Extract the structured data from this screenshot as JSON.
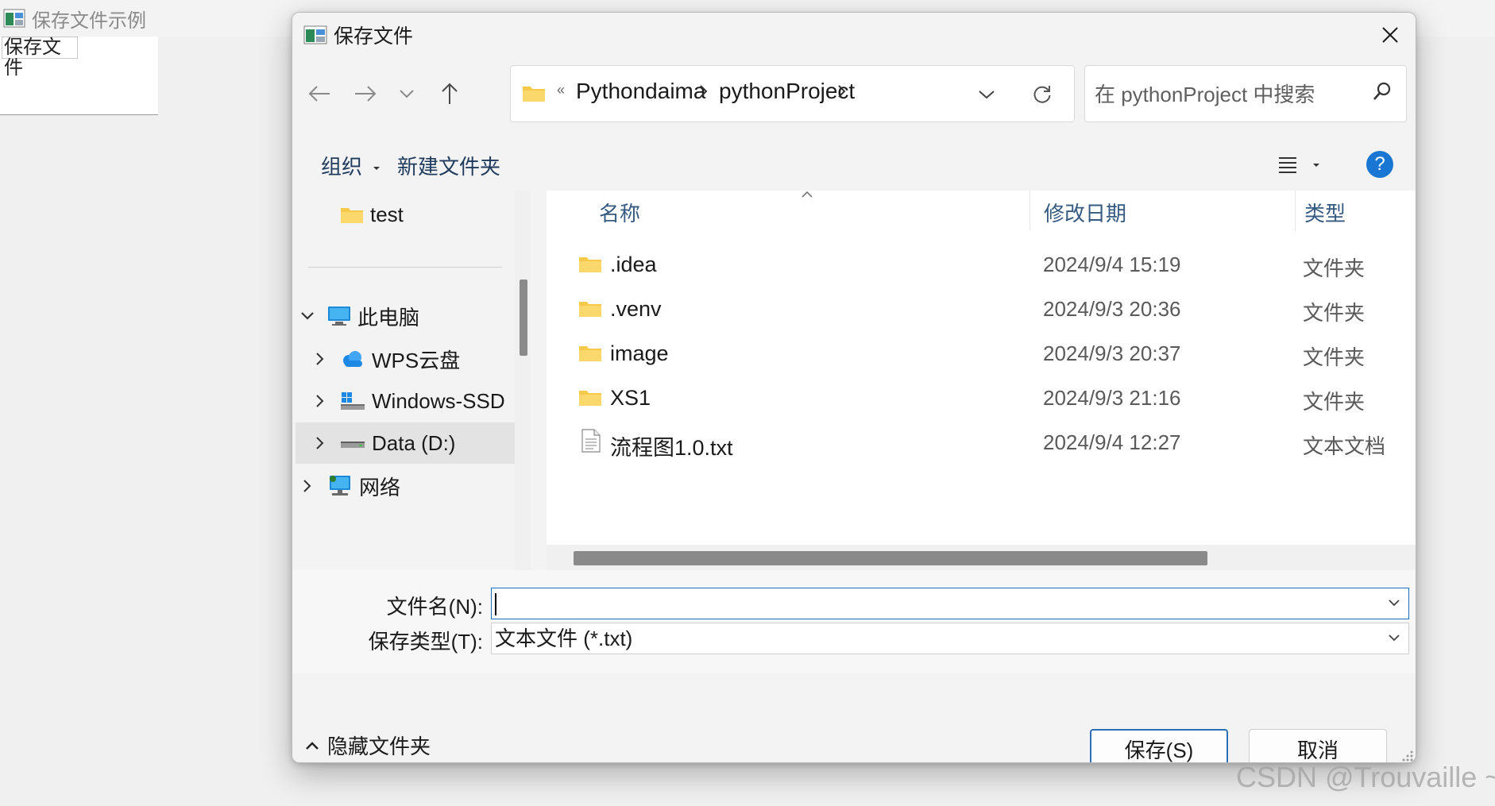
{
  "background_app": {
    "title": "保存文件示例",
    "button_label": "保存文件"
  },
  "dialog": {
    "title": "保存文件",
    "address": {
      "overflow_glyph": "«",
      "crumbs": [
        "Pythondaima",
        "pythonProject"
      ]
    },
    "search": {
      "placeholder": "在 pythonProject 中搜索"
    },
    "toolbar": {
      "organize_label": "组织",
      "new_folder_label": "新建文件夹",
      "help_label": "?"
    },
    "nav_pane": {
      "items": [
        {
          "label": "test",
          "icon": "folder-icon"
        },
        {
          "label": "此电脑",
          "icon": "computer-icon",
          "expanded": true
        },
        {
          "label": "WPS云盘",
          "icon": "cloud-icon"
        },
        {
          "label": "Windows-SSD",
          "icon": "drive-icon"
        },
        {
          "label": "Data (D:)",
          "icon": "drive-icon",
          "selected": true
        },
        {
          "label": "网络",
          "icon": "network-icon"
        }
      ]
    },
    "columns": {
      "name": "名称",
      "date": "修改日期",
      "type": "类型"
    },
    "files": [
      {
        "name": ".idea",
        "date": "2024/9/4 15:19",
        "type": "文件夹",
        "icon": "folder-icon"
      },
      {
        "name": ".venv",
        "date": "2024/9/3 20:36",
        "type": "文件夹",
        "icon": "folder-icon"
      },
      {
        "name": "image",
        "date": "2024/9/3 20:37",
        "type": "文件夹",
        "icon": "folder-icon"
      },
      {
        "name": "XS1",
        "date": "2024/9/3 21:16",
        "type": "文件夹",
        "icon": "folder-icon"
      },
      {
        "name": "流程图1.0.txt",
        "date": "2024/9/4 12:27",
        "type": "文本文档",
        "icon": "text-file-icon"
      }
    ],
    "form": {
      "filename_label": "文件名(N):",
      "filename_value": "",
      "filetype_label": "保存类型(T):",
      "filetype_value": "文本文件 (*.txt)"
    },
    "footer": {
      "hide_folders_label": "隐藏文件夹",
      "save_label": "保存(S)",
      "cancel_label": "取消"
    }
  },
  "watermark": "CSDN @Trouvaille ~",
  "colors": {
    "accent": "#1976d2",
    "folder_yellow": "#f7c948",
    "column_header": "#365a80"
  }
}
